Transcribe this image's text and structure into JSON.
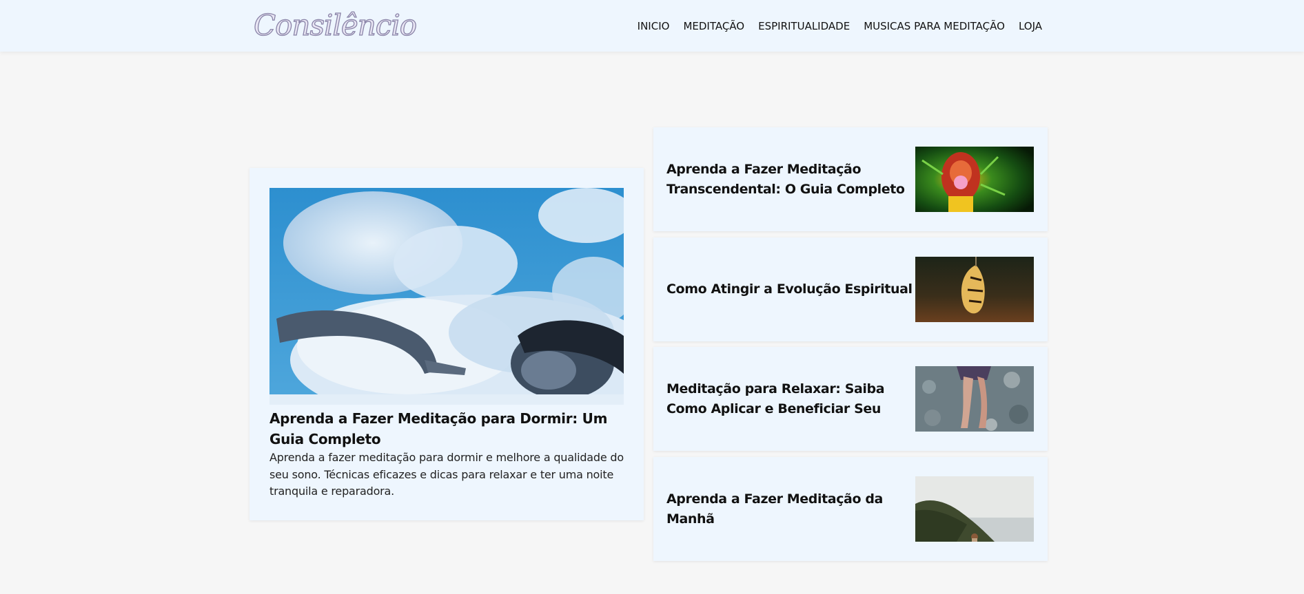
{
  "header": {
    "logo_text": "Consilêncio",
    "nav": [
      {
        "label": "INICIO"
      },
      {
        "label": "MEDITAÇÃO"
      },
      {
        "label": "ESPIRITUALIDADE"
      },
      {
        "label": "MUSICAS PARA MEDITAÇÃO"
      },
      {
        "label": "LOJA"
      }
    ]
  },
  "featured": {
    "image_alt": "person-sleeping-on-clouds",
    "title": "Aprenda a Fazer Meditação para Dormir: Um Guia Completo",
    "excerpt": "Aprenda a fazer meditação para dormir e melhore a qualidade do seu sono. Técnicas eficazes e dicas para relaxar e ter uma noite tranquila e reparadora."
  },
  "side_posts": [
    {
      "title": "Aprenda a Fazer Meditação Transcendental: O Guia Completo",
      "image": "psychedelic-meditation-figure"
    },
    {
      "title": "Como Atingir a Evolução Espiritual",
      "image": "butterfly-emerging-chrysalis"
    },
    {
      "title": "Meditação para Relaxar: Saiba Como Aplicar e Beneficiar Seu",
      "image": "person-sitting-on-pebbles"
    },
    {
      "title": "Aprenda a Fazer Meditação da Manhã",
      "image": "woman-by-coastal-cliff"
    }
  ],
  "colors": {
    "page_bg": "#f6f6f6",
    "header_bg": "#eef6fe",
    "card_bg": "#eef6fe",
    "text": "#111111"
  }
}
